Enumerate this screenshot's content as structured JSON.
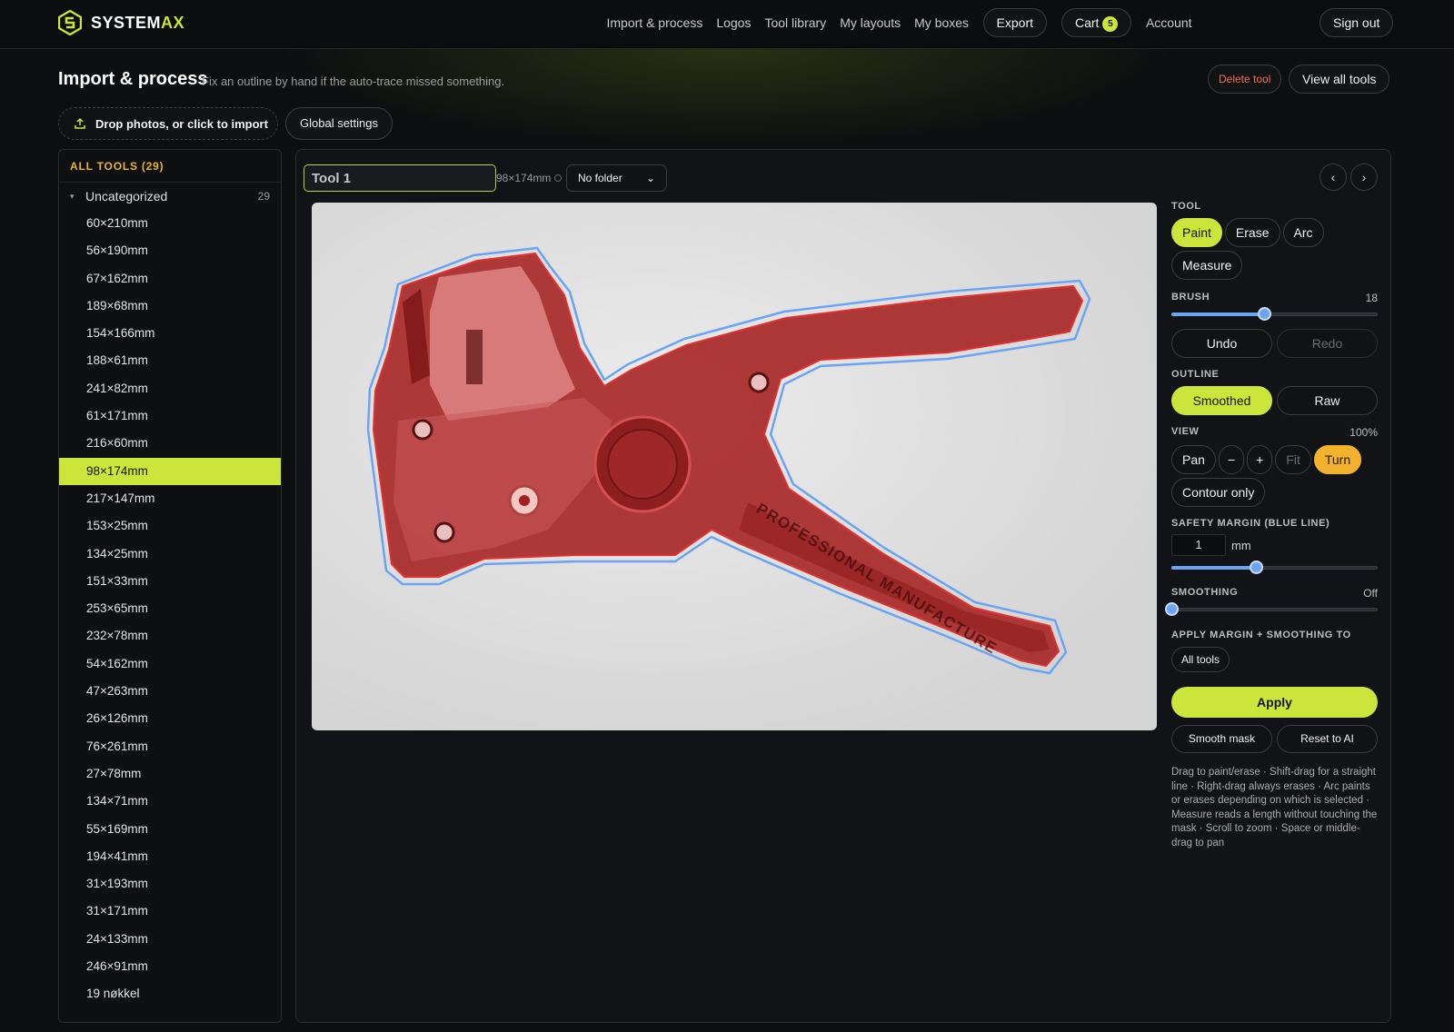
{
  "brand": {
    "name_main": "SYSTEM",
    "name_accent": "AX"
  },
  "nav": {
    "links": [
      "Import & process",
      "Logos",
      "Tool library",
      "My layouts",
      "My boxes"
    ],
    "export_label": "Export",
    "cart_label": "Cart",
    "cart_count": "5",
    "account_label": "Account",
    "signout_label": "Sign out"
  },
  "header": {
    "title": "Import & process",
    "subtitle": "Fix an outline by hand if the auto-trace missed something.",
    "delete_label": "Delete tool",
    "view_all_label": "View all tools",
    "import_label": "Drop photos, or click to import",
    "global_label": "Global settings"
  },
  "sidebar": {
    "heading": "ALL TOOLS (29)",
    "group_name": "Uncategorized",
    "group_count": "29",
    "active_index": 9,
    "items": [
      "60×210mm",
      "56×190mm",
      "67×162mm",
      "189×68mm",
      "154×166mm",
      "188×61mm",
      "241×82mm",
      "61×171mm",
      "216×60mm",
      "98×174mm",
      "217×147mm",
      "153×25mm",
      "134×25mm",
      "151×33mm",
      "253×65mm",
      "232×78mm",
      "54×162mm",
      "47×263mm",
      "26×126mm",
      "76×261mm",
      "27×78mm",
      "134×71mm",
      "55×169mm",
      "194×41mm",
      "31×193mm",
      "31×171mm",
      "24×133mm",
      "246×91mm",
      "19 nøkkel"
    ]
  },
  "editor": {
    "tool_name": "Tool 1",
    "dims": "98×174mm",
    "folder": "No folder",
    "prev_icon": "‹",
    "next_icon": "›",
    "image_text": "PROFESSIONAL MANUFACTURE"
  },
  "panel": {
    "tool_label": "TOOL",
    "tools": [
      "Paint",
      "Erase",
      "Arc",
      "Measure"
    ],
    "brush_label": "BRUSH",
    "brush_value": "18",
    "brush_fraction": 0.45,
    "undo_label": "Undo",
    "redo_label": "Redo",
    "outline_label": "OUTLINE",
    "smoothed_label": "Smoothed",
    "raw_label": "Raw",
    "view_label": "VIEW",
    "view_value": "100%",
    "pan_label": "Pan",
    "minus_label": "−",
    "plus_label": "+",
    "fit_label": "Fit",
    "turn_label": "Turn",
    "contour_label": "Contour only",
    "margin_label": "SAFETY MARGIN (BLUE LINE)",
    "margin_value": "1",
    "margin_unit": "mm",
    "margin_fraction": 0.41,
    "smoothing_label": "SMOOTHING",
    "smoothing_value": "Off",
    "smoothing_fraction": 0.0,
    "apply_to_label": "APPLY MARGIN + SMOOTHING TO",
    "apply_to_value": "All tools",
    "apply_label": "Apply",
    "smooth_mask_label": "Smooth mask",
    "reset_label": "Reset to AI",
    "help": "Drag to paint/erase · Shift-drag for a straight line · Right-drag always erases · Arc paints or erases depending on which is selected · Measure reads a length without touching the mask · Scroll to zoom · Space or middle-drag to pan"
  },
  "colors": {
    "accent": "#cbe53a",
    "orange": "#f2b22e",
    "danger": "#ef6a5a",
    "mask_red": "#b42020",
    "margin_blue": "#6aa4f2"
  }
}
